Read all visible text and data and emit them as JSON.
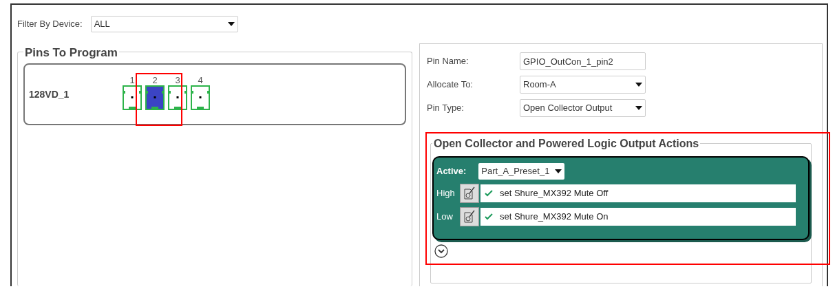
{
  "filter": {
    "label": "Filter By Device:",
    "value": "ALL"
  },
  "pins_to_program": {
    "title": "Pins To Program",
    "devices": [
      {
        "name": "128VD_1",
        "highlighted": true,
        "pins": [
          {
            "label": "1",
            "selected": false
          },
          {
            "label": "2",
            "selected": true
          },
          {
            "label": "3",
            "selected": false
          },
          {
            "label": "4",
            "selected": false
          }
        ]
      }
    ]
  },
  "pin_properties": [
    {
      "kind": "text",
      "label": "Pin Name:",
      "value": "GPIO_OutCon_1_pin2"
    },
    {
      "kind": "select",
      "label": "Allocate To:",
      "value": "Room-A"
    },
    {
      "kind": "select",
      "label": "Pin Type:",
      "value": "Open Collector Output"
    }
  ],
  "actions": {
    "highlighted": true,
    "title": "Open Collector and Powered Logic Output Actions",
    "active_label": "Active:",
    "active_value": "Part_A_Preset_1",
    "rows": [
      {
        "label": "High",
        "checked": true,
        "action": "set Shure_MX392 Mute Off"
      },
      {
        "label": "Low",
        "checked": true,
        "action": "set Shure_MX392 Mute On"
      }
    ]
  }
}
